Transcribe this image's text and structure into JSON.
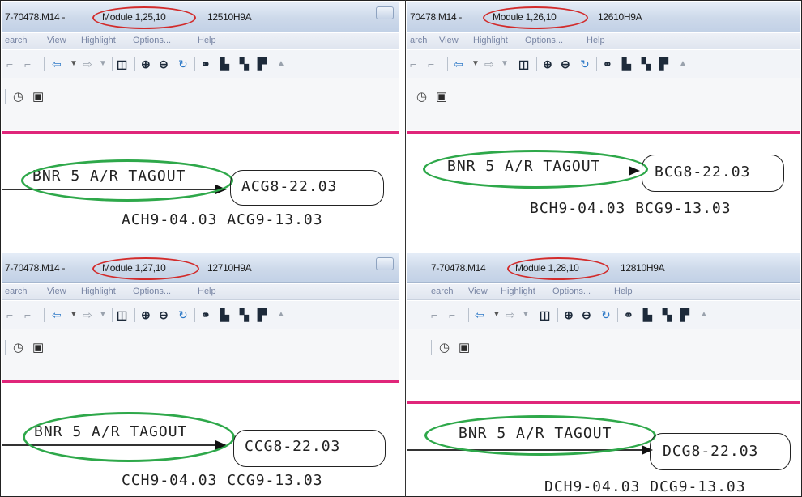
{
  "panels": [
    {
      "title_prefix": "7-70478.M14 -",
      "module": "Module 1,25,10",
      "title_suffix": "12510H9A",
      "menu": [
        "earch",
        "View",
        "Highlight",
        "Options...",
        "Help"
      ],
      "tagout": "BNR 5 A/R TAGOUT",
      "box_label": "ACG8-22.03",
      "bottom_label": "ACH9-04.03 ACG9-13.03"
    },
    {
      "title_prefix": "70478.M14 -",
      "module": "Module 1,26,10",
      "title_suffix": "12610H9A",
      "menu": [
        "arch",
        "View",
        "Highlight",
        "Options...",
        "Help"
      ],
      "tagout": "BNR 5 A/R TAGOUT",
      "box_label": "BCG8-22.03",
      "bottom_label": "BCH9-04.03 BCG9-13.03"
    },
    {
      "title_prefix": "7-70478.M14 -",
      "module": "Module 1,27,10",
      "title_suffix": "12710H9A",
      "menu": [
        "earch",
        "View",
        "Highlight",
        "Options...",
        "Help"
      ],
      "tagout": "BNR 5 A/R TAGOUT",
      "box_label": "CCG8-22.03",
      "bottom_label": "CCH9-04.03 CCG9-13.03"
    },
    {
      "title_prefix": "7-70478.M14",
      "module": "Module 1,28,10",
      "title_suffix": "12810H9A",
      "menu": [
        "earch",
        "View",
        "Highlight",
        "Options...",
        "Help"
      ],
      "tagout": "BNR 5 A/R TAGOUT",
      "box_label": "DCG8-22.03",
      "bottom_label": "DCH9-04.03 DCG9-13.03"
    }
  ],
  "icons": {
    "toolbar": [
      "undo-icon",
      "redo-icon",
      "back-arrow-icon",
      "dropdown-icon",
      "forward-arrow-icon",
      "dropdown-icon",
      "window-icon",
      "zoom-in-icon",
      "zoom-out-icon",
      "refresh-icon",
      "binoculars-icon",
      "find-icon",
      "find-next-icon",
      "find-all-icon",
      "scroll-up-icon"
    ],
    "toolbar2": [
      "clock-icon",
      "camera-icon"
    ]
  },
  "colors": {
    "highlight_green": "#2ea84a",
    "highlight_red": "#d22b2b",
    "separator_pink": "#e0267a",
    "back_arrow_blue": "#2d79c7"
  }
}
